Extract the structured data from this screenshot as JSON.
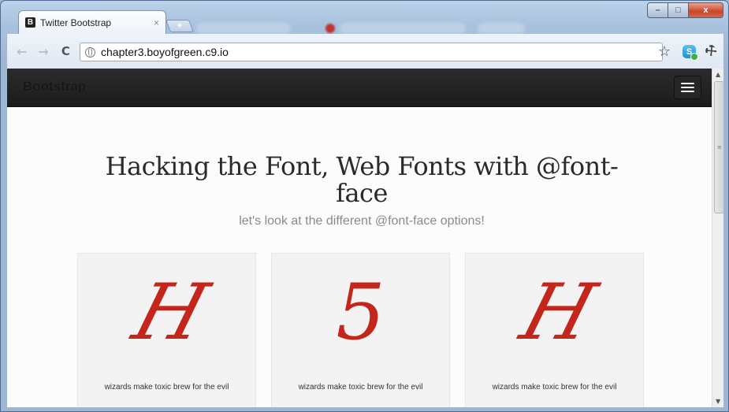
{
  "browser": {
    "tab_title": "Twitter Bootstrap",
    "tab_favicon": "B",
    "tab_close": "×",
    "new_tab": "+",
    "url": "chapter3.boyofgreen.c9.io",
    "nav_icons": [
      "back-icon",
      "forward-icon",
      "reload-icon"
    ],
    "toolbar_icons": [
      "bookmark-star-icon",
      "skype-icon",
      "wrench-icon"
    ],
    "window_controls": {
      "minimize": "–",
      "maximize": "□",
      "close": "x"
    }
  },
  "navbar": {
    "brand": "Bootstrap",
    "toggle_icon": "menu-icon"
  },
  "hero": {
    "title": "Hacking the Font, Web Fonts with @font-face",
    "subtitle": "let's look at the different @font-face options!"
  },
  "cards": [
    {
      "glyph": "H",
      "caption": "wizards make toxic brew for the evil"
    },
    {
      "glyph": "5",
      "caption": "wizards make toxic brew for the evil"
    },
    {
      "glyph": "H",
      "caption": "wizards make toxic brew for the evil"
    }
  ],
  "colors": {
    "navbar_bg": "#1b1b1b",
    "glyph": "#c4261c",
    "window_frame": "#a9c2de"
  }
}
